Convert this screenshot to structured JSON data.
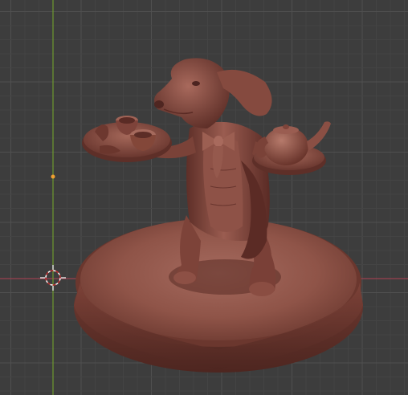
{
  "app": "Blender",
  "viewport": {
    "mode": "sculpt",
    "background_color": "#3d3d3d",
    "grid_minor_color": "#444444",
    "grid_major_color": "#505050",
    "axis_x_color": "#9a4150",
    "axis_y_color": "#6e9a2e",
    "material_color": "#8a4e44",
    "object": {
      "name": "dachshund-butler-sculpt",
      "description_icon": "sculpt-mesh"
    }
  },
  "gizmos": {
    "cursor_3d": "3d-cursor-icon",
    "origin_marker": "origin-dot-icon"
  }
}
